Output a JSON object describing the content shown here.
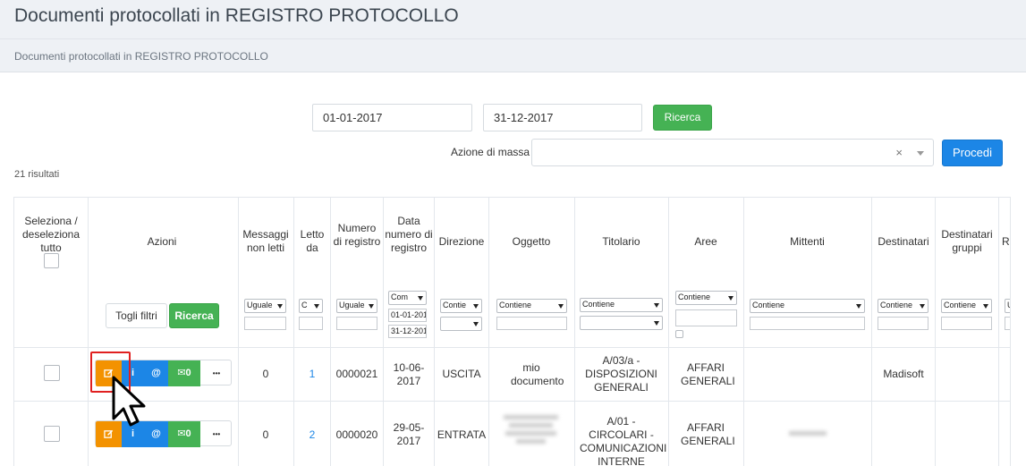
{
  "page": {
    "title": "Documenti protocollati in REGISTRO PROTOCOLLO",
    "breadcrumb": "Documenti protocollati in REGISTRO PROTOCOLLO"
  },
  "search": {
    "date_from": "01-01-2017",
    "date_to": "31-12-2017",
    "search_label": "Ricerca"
  },
  "mass_action": {
    "label": "Azione di massa",
    "clear": "×",
    "proceed_label": "Procedi"
  },
  "results_count": "21 risultati",
  "columns": {
    "select_all": "Seleziona / deseleziona tutto",
    "actions": "Azioni",
    "unread": "Messaggi non letti",
    "read_by": "Letto da",
    "reg_number": "Numero di registro",
    "reg_date": "Data numero di registro",
    "direction": "Direzione",
    "subject": "Oggetto",
    "classification": "Titolario",
    "areas": "Aree",
    "senders": "Mittenti",
    "recipients": "Destinatari",
    "group_recipients": "Destinatari gruppi",
    "next": "R"
  },
  "filters": {
    "toggle_filters": "Togli filtri",
    "search": "Ricerca",
    "unread": "Uguale",
    "read_by": "C",
    "reg_number": "Uguale",
    "reg_date": "Com",
    "reg_date_from": "01-01-201",
    "reg_date_to": "31-12-201",
    "direction": "Contie",
    "subject": "Contiene",
    "classification": "Contiene",
    "areas": "Contiene",
    "senders": "Contiene",
    "recipients": "Contiene",
    "group_recipients": "Contiene",
    "next": "U"
  },
  "row_actions": {
    "info": "i",
    "email": "@",
    "mail_count": "0",
    "more": "•••"
  },
  "rows": [
    {
      "unread": "0",
      "read_by": "1",
      "reg_number": "0000021",
      "reg_date": "10-06-2017",
      "direction": "USCITA",
      "subject": "mio documento",
      "classification": "A/03/a - DISPOSIZIONI GENERALI",
      "areas": "AFFARI GENERALI",
      "senders": "",
      "recipients": "Madisoft"
    },
    {
      "unread": "0",
      "read_by": "2",
      "reg_number": "0000020",
      "reg_date": "29-05-2017",
      "direction": "ENTRATA",
      "subject": "",
      "classification": "A/01 - CIRCOLARI -COMUNICAZIONI INTERNE",
      "areas": "AFFARI GENERALI",
      "senders": "",
      "recipients": ""
    }
  ],
  "colors": {
    "green": "#45b254",
    "blue": "#1c86e6",
    "orange": "#f39200",
    "highlight": "#e02020"
  }
}
